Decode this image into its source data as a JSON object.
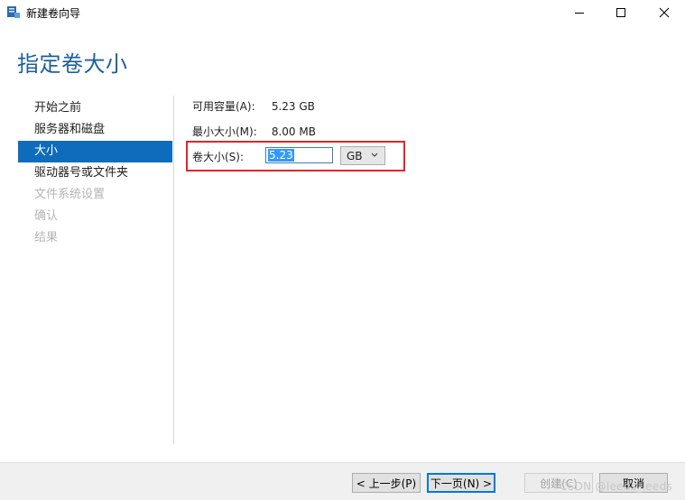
{
  "window": {
    "title": "新建卷向导",
    "icon": "volume-wizard-icon",
    "controls": [
      "minimize-icon",
      "maximize-icon",
      "close-icon"
    ]
  },
  "page": {
    "heading": "指定卷大小"
  },
  "nav": {
    "items": [
      {
        "label": "开始之前",
        "state": "normal"
      },
      {
        "label": "服务器和磁盘",
        "state": "normal"
      },
      {
        "label": "大小",
        "state": "selected"
      },
      {
        "label": "驱动器号或文件夹",
        "state": "normal"
      },
      {
        "label": "文件系统设置",
        "state": "disabled"
      },
      {
        "label": "确认",
        "state": "disabled"
      },
      {
        "label": "结果",
        "state": "disabled"
      }
    ]
  },
  "form": {
    "available": {
      "label": "可用容量(A):",
      "value": "5.23 GB"
    },
    "minimum": {
      "label": "最小大小(M):",
      "value": "8.00 MB"
    },
    "size": {
      "label": "卷大小(S):",
      "value": "5.23",
      "unit": "GB"
    }
  },
  "buttons": {
    "prev": "< 上一步(P)",
    "next": "下一页(N) >",
    "create": "创建(C)",
    "cancel": "取消"
  },
  "watermark": "CSDN @leeds_leeds",
  "colors": {
    "heading": "#1e5f9f",
    "nav_selected_bg": "#0f6cbd",
    "highlight_border": "#e3242b",
    "disabled_text": "#b5b5b5"
  }
}
